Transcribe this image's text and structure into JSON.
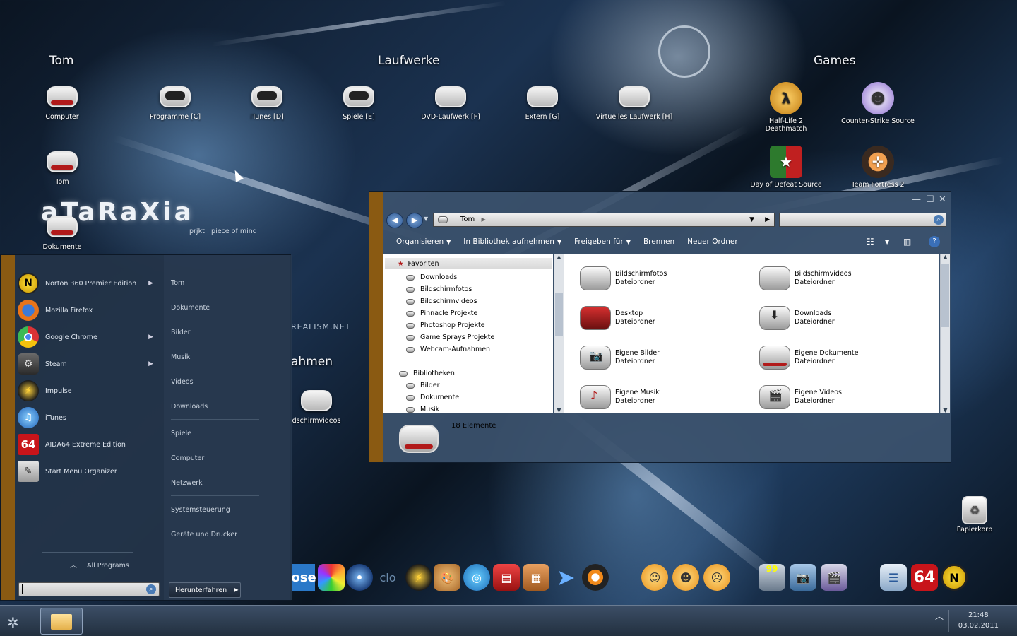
{
  "desktop": {
    "groups": {
      "tom": "Tom",
      "laufwerke": "Laufwerke",
      "games": "Games",
      "ahmen": "ahmen"
    },
    "wallpaper_text": {
      "logo": "aTaRaXia",
      "tagline": "prjkt : piece of mind",
      "realism": "REALISM.NET"
    },
    "icons": {
      "computer": "Computer",
      "tom": "Tom",
      "dokumente": "Dokumente",
      "programme": "Programme [C]",
      "itunes": "iTunes [D]",
      "spiele": "Spiele [E]",
      "dvd": "DVD-Laufwerk [F]",
      "extern": "Extern [G]",
      "virtuelles": "Virtuelles Laufwerk [H]",
      "halflife": "Half-Life 2 Deathmatch",
      "cs": "Counter-Strike Source",
      "dod": "Day of Defeat Source",
      "tf2": "Team Fortress 2",
      "bildschirmvideos": "dschirmvideos",
      "papierkorb": "Papierkorb"
    }
  },
  "start_menu": {
    "programs": [
      {
        "label": "Norton 360 Premier Edition",
        "icon": "norton-icon",
        "submenu": true
      },
      {
        "label": "Mozilla Firefox",
        "icon": "firefox-icon",
        "submenu": false
      },
      {
        "label": "Google Chrome",
        "icon": "chrome-icon",
        "submenu": true
      },
      {
        "label": "Steam",
        "icon": "steam-icon",
        "submenu": true
      },
      {
        "label": "Impulse",
        "icon": "impulse-icon",
        "submenu": false
      },
      {
        "label": "iTunes",
        "icon": "itunes-icon",
        "submenu": false
      },
      {
        "label": "AIDA64 Extreme Edition",
        "icon": "aida64-icon",
        "submenu": false
      },
      {
        "label": "Start Menu Organizer",
        "icon": "organizer-icon",
        "submenu": false
      }
    ],
    "all_programs": "All Programs",
    "right_links": [
      "Tom",
      "Dokumente",
      "Bilder",
      "Musik",
      "Videos",
      "Downloads",
      "Spiele",
      "Computer",
      "Netzwerk",
      "Systemsteuerung",
      "Geräte und Drucker"
    ],
    "shutdown_label": "Herunterfahren",
    "search_value": ""
  },
  "explorer": {
    "address": "Tom",
    "toolbar": {
      "organize": "Organisieren",
      "library": "In Bibliothek aufnehmen",
      "share": "Freigeben für",
      "burn": "Brennen",
      "new_folder": "Neuer Ordner"
    },
    "nav": {
      "favorites": "Favoriten",
      "favorite_items": [
        "Downloads",
        "Bildschirmfotos",
        "Bildschirmvideos",
        "Pinnacle Projekte",
        "Photoshop Projekte",
        "Game Sprays Projekte",
        "Webcam-Aufnahmen"
      ],
      "libraries": "Bibliotheken",
      "library_items": [
        "Bilder",
        "Dokumente",
        "Musik"
      ]
    },
    "files": [
      {
        "name": "Bildschirmfotos",
        "type": "Dateiordner"
      },
      {
        "name": "Bildschirmvideos",
        "type": "Dateiordner"
      },
      {
        "name": "Desktop",
        "type": "Dateiordner"
      },
      {
        "name": "Downloads",
        "type": "Dateiordner"
      },
      {
        "name": "Eigene Bilder",
        "type": "Dateiordner"
      },
      {
        "name": "Eigene Dokumente",
        "type": "Dateiordner"
      },
      {
        "name": "Eigene Musik",
        "type": "Dateiordner"
      },
      {
        "name": "Eigene Videos",
        "type": "Dateiordner"
      }
    ],
    "item_count": "18 Elemente"
  },
  "dock": {
    "text": "ose",
    "text2": "clo",
    "badge": "64",
    "badge2": "99"
  },
  "taskbar": {
    "time": "21:48",
    "date": "03.02.2011"
  },
  "colors": {
    "accent_stripe": "#8a5a12",
    "panel": "#243448",
    "taskbar": "#2c3b4f"
  }
}
